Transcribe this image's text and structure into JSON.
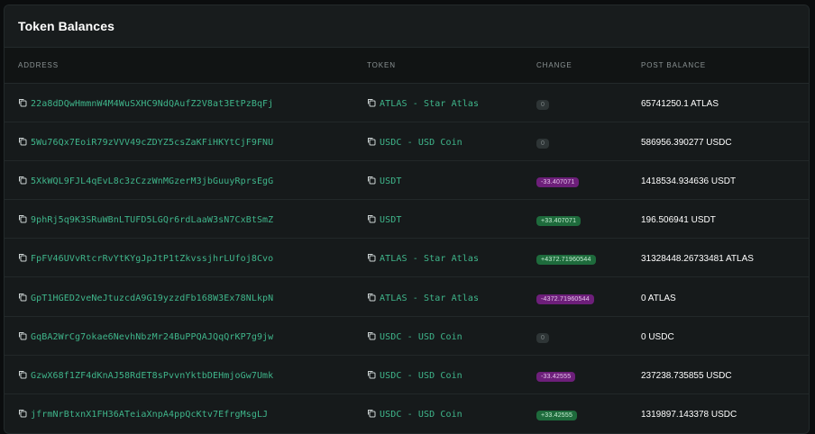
{
  "title": "Token Balances",
  "columns": {
    "address": "ADDRESS",
    "token": "TOKEN",
    "change": "CHANGE",
    "post_balance": "POST BALANCE"
  },
  "colors": {
    "link": "#3fb68b",
    "negative_badge": "#6d1f7a",
    "positive_badge": "#1e6b3c",
    "neutral_badge": "#2e3536"
  },
  "rows": [
    {
      "address": "22a8dDQwHmmnW4M4WuSXHC9NdQAufZ2V8at3EtPzBqFj",
      "token": "ATLAS - Star Atlas",
      "change": "0",
      "change_type": "neutral",
      "post_balance": "65741250.1 ATLAS"
    },
    {
      "address": "5Wu76Qx7EoiR79zVVV49cZDYZ5csZaKFiHKYtCjF9FNU",
      "token": "USDC - USD Coin",
      "change": "0",
      "change_type": "neutral",
      "post_balance": "586956.390277 USDC"
    },
    {
      "address": "5XkWQL9FJL4qEvL8c3zCzzWnMGzerM3jbGuuyRprsEgG",
      "token": "USDT",
      "change": "-33.407071",
      "change_type": "neg",
      "post_balance": "1418534.934636 USDT"
    },
    {
      "address": "9phRj5q9K3SRuWBnLTUFD5LGQr6rdLaaW3sN7CxBtSmZ",
      "token": "USDT",
      "change": "+33.407071",
      "change_type": "pos",
      "post_balance": "196.506941 USDT"
    },
    {
      "address": "FpFV46UVvRtcrRvYtKYgJpJtP1tZkvssjhrLUfoj8Cvo",
      "token": "ATLAS - Star Atlas",
      "change": "+4372.71960544",
      "change_type": "pos",
      "post_balance": "31328448.26733481 ATLAS"
    },
    {
      "address": "GpT1HGED2veNeJtuzcdA9G19yzzdFb168W3Ex78NLkpN",
      "token": "ATLAS - Star Atlas",
      "change": "-4372.71960544",
      "change_type": "neg",
      "post_balance": "0 ATLAS"
    },
    {
      "address": "GqBA2WrCg7okae6NevhNbzMr24BuPPQAJQqQrKP7g9jw",
      "token": "USDC - USD Coin",
      "change": "0",
      "change_type": "neutral",
      "post_balance": "0 USDC"
    },
    {
      "address": "GzwX68f1ZF4dKnAJ58RdET8sPvvnYktbDEHmjoGw7Umk",
      "token": "USDC - USD Coin",
      "change": "-33.42555",
      "change_type": "neg",
      "post_balance": "237238.735855 USDC"
    },
    {
      "address": "jfrmNrBtxnX1FH36ATeiaXnpA4ppQcKtv7EfrgMsgLJ",
      "token": "USDC - USD Coin",
      "change": "+33.42555",
      "change_type": "pos",
      "post_balance": "1319897.143378 USDC"
    }
  ]
}
